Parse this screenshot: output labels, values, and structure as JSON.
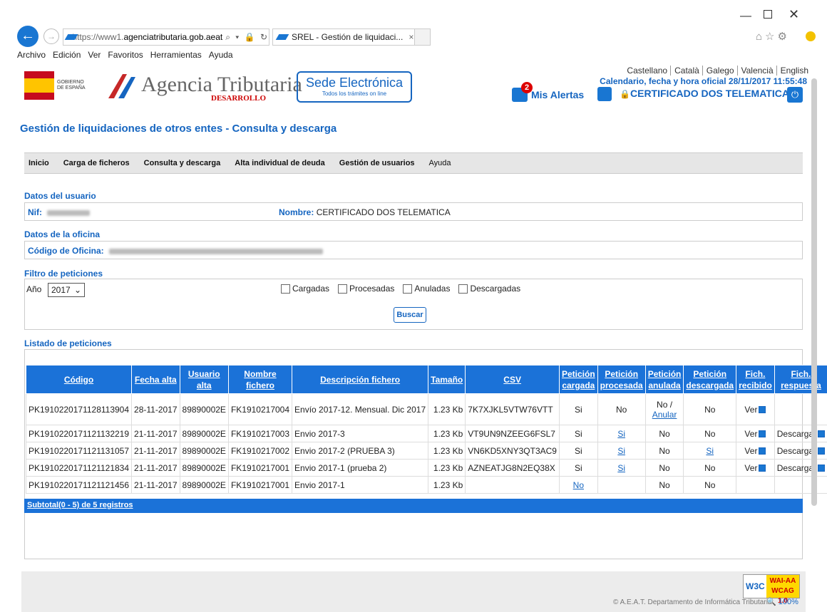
{
  "browser": {
    "url_prefix": "https://www1.",
    "url_domain": "agenciatributaria.gob.aeat",
    "url_tools": "⌕ ▾ 🔒 ↻",
    "tab_title": "SREL - Gestión de liquidaci...",
    "menu": [
      "Archivo",
      "Edición",
      "Ver",
      "Favoritos",
      "Herramientas",
      "Ayuda"
    ]
  },
  "header": {
    "gobierno": "GOBIERNO DE ESPAÑA",
    "agency": "Agencia Tributaria",
    "env": "DESARROLLO",
    "sede_main": "Sede Electrónica",
    "sede_sub": "Todos los trámites on line",
    "languages": [
      "Castellano",
      "Català",
      "Galego",
      "Valencià",
      "English"
    ],
    "calendar": "Calendario, fecha y hora oficial 28/11/2017 11:55:48",
    "alert_count": "2",
    "alerts_label": "Mis Alertas",
    "certificate": "CERTIFICADO DOS TELEMATICA"
  },
  "page_title": "Gestión de liquidaciones de otros entes - Consulta y descarga",
  "nav": [
    "Inicio",
    "Carga de ficheros",
    "Consulta y descarga",
    "Alta individual de deuda",
    "Gestión de usuarios",
    "Ayuda"
  ],
  "user": {
    "section": "Datos del usuario",
    "nif_label": "Nif:",
    "nombre_label": "Nombre:",
    "nombre": "CERTIFICADO DOS TELEMATICA"
  },
  "office": {
    "section": "Datos de la oficina",
    "code_label": "Código de Oficina:"
  },
  "filter": {
    "section": "Filtro de peticiones",
    "year_label": "Año",
    "year": "2017",
    "checkboxes": [
      "Cargadas",
      "Procesadas",
      "Anuladas",
      "Descargadas"
    ],
    "search_button": "Buscar"
  },
  "listing": {
    "section": "Listado de peticiones",
    "headers": [
      "Código",
      "Fecha alta",
      "Usuario alta",
      "Nombre fichero",
      "Descripción fichero",
      "Tamaño",
      "CSV",
      "Petición cargada",
      "Petición procesada",
      "Petición anulada",
      "Petición descargada",
      "Fich. recibido",
      "Fich. respuesta"
    ],
    "rows": [
      {
        "codigo": "PK1910220171128113904",
        "fecha": "28-11-2017",
        "usuario": "89890002E",
        "fichero": "FK1910217004",
        "descripcion": "Envío 2017-12. Mensual. Dic 2017",
        "tamano": "1.23 Kb",
        "csv": "7K7XJKL5VTW76VTT",
        "cargada": "Si",
        "procesada": "No",
        "anulada": "No /",
        "anulada_link": "Anular",
        "descargada": "No",
        "recibido": "Ver",
        "respuesta": ""
      },
      {
        "codigo": "PK1910220171121132219",
        "fecha": "21-11-2017",
        "usuario": "89890002E",
        "fichero": "FK1910217003",
        "descripcion": "Envio 2017-3",
        "tamano": "1.23 Kb",
        "csv": "VT9UN9NZEEG6FSL7",
        "cargada": "Si",
        "procesada": "Si",
        "anulada": "No",
        "anulada_link": "",
        "descargada": "No",
        "recibido": "Ver",
        "respuesta": "Descargar"
      },
      {
        "codigo": "PK1910220171121131057",
        "fecha": "21-11-2017",
        "usuario": "89890002E",
        "fichero": "FK1910217002",
        "descripcion": "Envio 2017-2 (PRUEBA 3)",
        "tamano": "1.23 Kb",
        "csv": "VN6KD5XNY3QT3AC9",
        "cargada": "Si",
        "procesada": "Si",
        "anulada": "No",
        "anulada_link": "",
        "descargada": "Si",
        "recibido": "Ver",
        "respuesta": "Descargar"
      },
      {
        "codigo": "PK1910220171121121834",
        "fecha": "21-11-2017",
        "usuario": "89890002E",
        "fichero": "FK1910217001",
        "descripcion": "Envio 2017-1 (prueba 2)",
        "tamano": "1.23 Kb",
        "csv": "AZNEATJG8N2EQ38X",
        "cargada": "Si",
        "procesada": "Si",
        "anulada": "No",
        "anulada_link": "",
        "descargada": "No",
        "recibido": "Ver",
        "respuesta": "Descargar"
      },
      {
        "codigo": "PK1910220171121121456",
        "fecha": "21-11-2017",
        "usuario": "89890002E",
        "fichero": "FK1910217001",
        "descripcion": "Envio 2017-1",
        "tamano": "1.23 Kb",
        "csv": "",
        "cargada": "No",
        "procesada": "",
        "anulada": "No",
        "anulada_link": "",
        "descargada": "No",
        "recibido": "",
        "respuesta": ""
      }
    ],
    "subtotal": "Subtotal(0 - 5) de 5 registros"
  },
  "footer": {
    "text": "© A.E.A.T. Departamento de Informática Tributaria",
    "badge_a": "W3C",
    "badge_b": "WAI-AA WCAG 1.0",
    "zoom": "🔍 100%"
  }
}
